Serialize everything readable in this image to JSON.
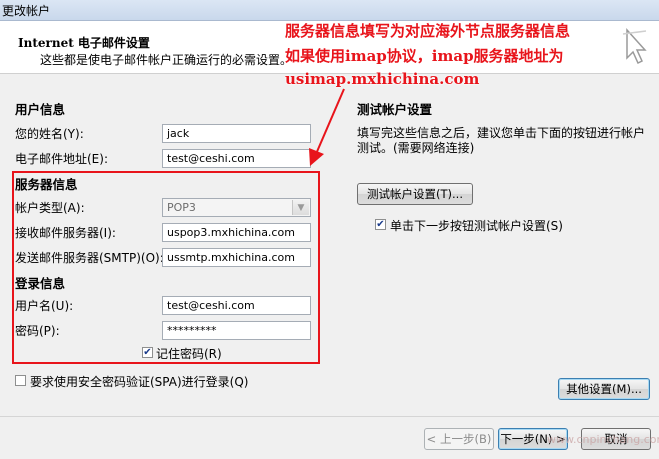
{
  "window": {
    "title": "更改帐户"
  },
  "header": {
    "title": "Internet 电子邮件设置",
    "subtitle": "这些都是使电子邮件帐户正确运行的必需设置。"
  },
  "user_info": {
    "heading": "用户信息",
    "name_label": "您的姓名(Y):",
    "name_value": "jack",
    "email_label": "电子邮件地址(E):",
    "email_value": "test@ceshi.com"
  },
  "server_info": {
    "heading": "服务器信息",
    "account_type_label": "帐户类型(A):",
    "account_type_value": "POP3",
    "incoming_label": "接收邮件服务器(I):",
    "incoming_value": "uspop3.mxhichina.com",
    "outgoing_label": "发送邮件服务器(SMTP)(O):",
    "outgoing_value": "ussmtp.mxhichina.com"
  },
  "login_info": {
    "heading": "登录信息",
    "username_label": "用户名(U):",
    "username_value": "test@ceshi.com",
    "password_label": "密码(P):",
    "password_value": "*********",
    "remember_label": "记住密码(R)",
    "remember_checked": true
  },
  "spa": {
    "label": "要求使用安全密码验证(SPA)进行登录(Q)",
    "checked": false
  },
  "test_settings": {
    "heading": "测试帐户设置",
    "description_line1": "填写完这些信息之后，建议您单击下面的按钮进行帐户",
    "description_line2": "测试。(需要网络连接)",
    "test_button": "测试帐户设置(T)...",
    "auto_test_label": "单击下一步按钮测试帐户设置(S)",
    "auto_test_checked": true
  },
  "buttons": {
    "more_settings": "其他设置(M)...",
    "back": "< 上一步(B)",
    "next": "下一步(N) >",
    "cancel": "取消"
  },
  "annotation": {
    "line1": "服务器信息填写为对应海外节点服务器信息",
    "line2": "如果使用imap协议，imap服务器地址为",
    "line3": "usimap.mxhichina.com",
    "color": "#e8141b"
  },
  "watermark": "www.cnpinchang.com",
  "colors": {
    "window_bg": "#f0f0f0",
    "annotation_red": "#e8141b",
    "title_bar": "#d3e0f1"
  },
  "icons": [
    "cursor-arrow-icon",
    "dropdown-arrow-icon",
    "check-icon",
    "red-arrow"
  ]
}
